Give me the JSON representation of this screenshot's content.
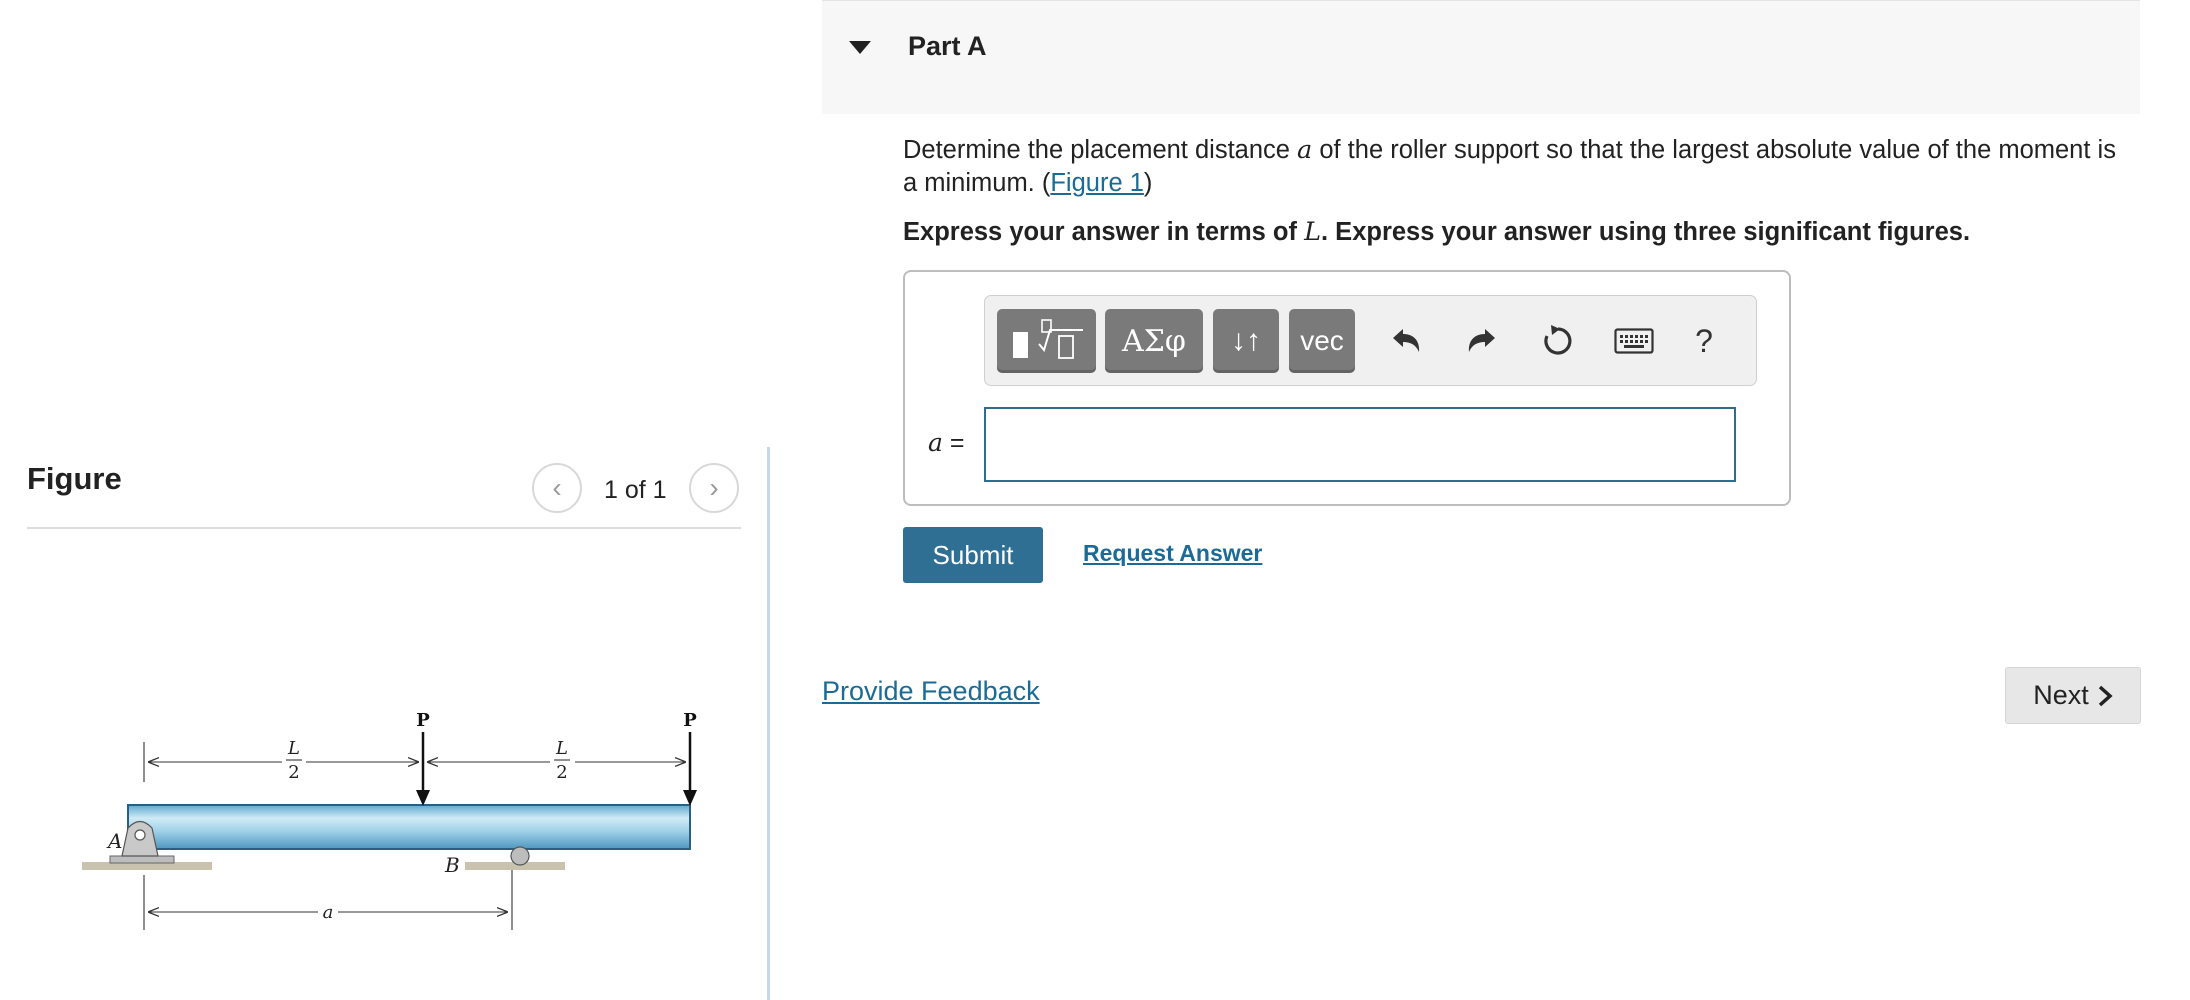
{
  "figure_panel": {
    "title": "Figure",
    "counter": "1 of 1",
    "prev_glyph": "‹",
    "next_glyph": "›",
    "diagram_labels": {
      "load1": "P",
      "load2": "P",
      "half_span_left_num": "L",
      "half_span_left_den": "2",
      "half_span_right_num": "L",
      "half_span_right_den": "2",
      "support_a": "A",
      "support_b": "B",
      "dimension_a": "a"
    }
  },
  "part": {
    "title": "Part A",
    "toggle_icon": "caret-down-icon"
  },
  "question": {
    "text_before_var": "Determine the placement distance ",
    "var": "a",
    "text_after_var": " of the roller support so that the largest absolute value of the moment is a minimum. (",
    "figure_link": "Figure 1",
    "text_end": ")"
  },
  "instructions": {
    "text_before_var": "Express your answer in terms of ",
    "var": "L",
    "text_after_var": ". Express your answer using three significant figures."
  },
  "toolbar": {
    "greek_label": "ΑΣφ",
    "arrows_label": "↓↑",
    "vec_label": "vec",
    "help_label": "?",
    "icons": [
      "templates-icon",
      "undo-icon",
      "redo-icon",
      "reset-icon",
      "keyboard-icon",
      "help-icon"
    ]
  },
  "answer": {
    "label_var": "a",
    "label_eq": " =",
    "value": ""
  },
  "actions": {
    "submit_label": "Submit",
    "request_answer_label": "Request Answer",
    "provide_feedback_label": "Provide Feedback",
    "next_label": "Next"
  },
  "colors": {
    "accent": "#2e6f93",
    "link": "#1b6b96",
    "beam_fill": "#9fd0e8",
    "toolbar_button": "#7a7a7a"
  }
}
